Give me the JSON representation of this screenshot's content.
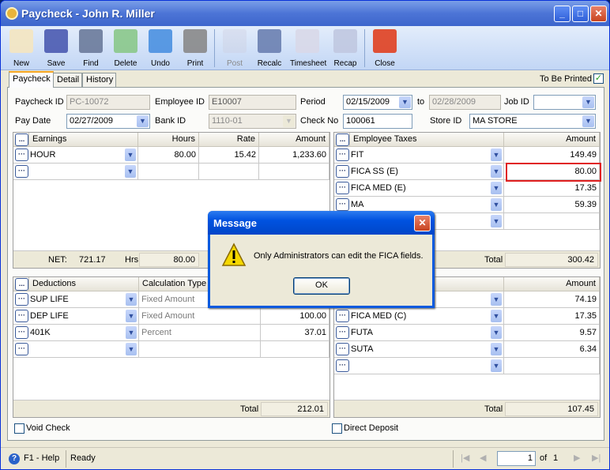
{
  "window": {
    "title": "Paycheck - John R. Miller"
  },
  "toolbar": [
    {
      "label": "New",
      "icon": "new-icon"
    },
    {
      "label": "Save",
      "icon": "save-icon"
    },
    {
      "label": "Find",
      "icon": "binoculars-icon"
    },
    {
      "label": "Delete",
      "icon": "recycle-bin-icon"
    },
    {
      "label": "Undo",
      "icon": "undo-icon"
    },
    {
      "label": "Print",
      "icon": "printer-icon"
    },
    {
      "label": "Post",
      "icon": "post-icon",
      "disabled": true
    },
    {
      "label": "Recalc",
      "icon": "calculator-icon"
    },
    {
      "label": "Timesheet",
      "icon": "timesheet-icon"
    },
    {
      "label": "Recap",
      "icon": "recap-icon"
    },
    {
      "label": "Close",
      "icon": "close-window-icon"
    }
  ],
  "tabs": [
    "Paycheck",
    "Detail",
    "History"
  ],
  "to_be_printed": {
    "label": "To Be Printed",
    "checked": true
  },
  "form": {
    "paycheck_id": {
      "label": "Paycheck ID",
      "value": "PC-10072"
    },
    "employee_id": {
      "label": "Employee ID",
      "value": "E10007"
    },
    "period": {
      "label": "Period",
      "from": "02/15/2009",
      "to_label": "to",
      "to": "02/28/2009"
    },
    "job_id": {
      "label": "Job ID",
      "value": ""
    },
    "pay_date": {
      "label": "Pay Date",
      "value": "02/27/2009"
    },
    "bank_id": {
      "label": "Bank ID",
      "value": "1110-01"
    },
    "check_no": {
      "label": "Check No",
      "value": "100061"
    },
    "store_id": {
      "label": "Store ID",
      "value": "MA STORE"
    }
  },
  "earnings": {
    "headers": [
      "Earnings",
      "Hours",
      "Rate",
      "Amount"
    ],
    "rows": [
      [
        "HOUR",
        "80.00",
        "15.42",
        "1,233.60"
      ],
      [
        "",
        "",
        "",
        ""
      ]
    ],
    "net_label": "NET:",
    "net": "721.17",
    "hrs_label": "Hrs",
    "hrs": "80.00"
  },
  "employee_taxes": {
    "headers": [
      "Employee Taxes",
      "Amount"
    ],
    "rows": [
      [
        "FIT",
        "149.49"
      ],
      [
        "FICA SS (E)",
        "80.00"
      ],
      [
        "FICA MED (E)",
        "17.35"
      ],
      [
        "MA",
        "59.39"
      ],
      [
        "",
        ""
      ]
    ],
    "total_label": "Total",
    "total": "300.42",
    "highlight_color": "#e02020"
  },
  "deductions": {
    "headers": [
      "Deductions",
      "Calculation Type"
    ],
    "rows": [
      [
        "SUP LIFE",
        "Fixed Amount",
        ""
      ],
      [
        "DEP LIFE",
        "Fixed Amount",
        "100.00"
      ],
      [
        "401K",
        "Percent",
        "37.01"
      ],
      [
        "",
        "",
        ""
      ]
    ],
    "total_label": "Total",
    "total": "212.01"
  },
  "employer_taxes": {
    "headers": [
      "",
      "Amount"
    ],
    "rows": [
      [
        "",
        "74.19"
      ],
      [
        "FICA MED (C)",
        "17.35"
      ],
      [
        "FUTA",
        "9.57"
      ],
      [
        "SUTA",
        "6.34"
      ],
      [
        "",
        ""
      ]
    ],
    "total_label": "Total",
    "total": "107.45"
  },
  "void_check": {
    "label": "Void Check",
    "checked": false
  },
  "direct_deposit": {
    "label": "Direct Deposit",
    "checked": false
  },
  "status": {
    "help": "F1 - Help",
    "state": "Ready",
    "page": "1",
    "of_label": "of",
    "pages": "1"
  },
  "dialog": {
    "title": "Message",
    "message": "Only Administrators can edit the FICA fields.",
    "ok": "OK"
  }
}
